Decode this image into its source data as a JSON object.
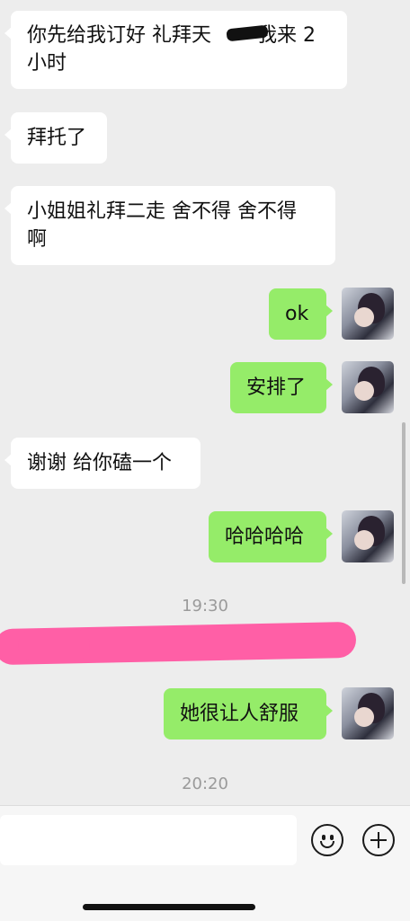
{
  "messages": [
    {
      "side": "left",
      "text": "你先给我订好 礼拜天   我来 2\n小时"
    },
    {
      "side": "left",
      "text": "拜托了"
    },
    {
      "side": "left",
      "text": "小姐姐礼拜二走 舍不得 舍不得\n啊"
    },
    {
      "side": "right",
      "text": "ok"
    },
    {
      "side": "right",
      "text": "安排了"
    },
    {
      "side": "left",
      "text": "谢谢 给你磕一个"
    },
    {
      "side": "right",
      "text": "哈哈哈哈"
    },
    {
      "side": "right",
      "text": "她很让人舒服"
    }
  ],
  "timestamps": [
    "19:30",
    "20:20"
  ],
  "input": {
    "placeholder": ""
  },
  "icons": {
    "emoji": "emoji-face-icon",
    "more": "plus-circle-icon"
  },
  "colors": {
    "background": "#ededed",
    "sent_bubble": "#95ec69",
    "received_bubble": "#ffffff",
    "redaction": "#ff5fa6"
  }
}
